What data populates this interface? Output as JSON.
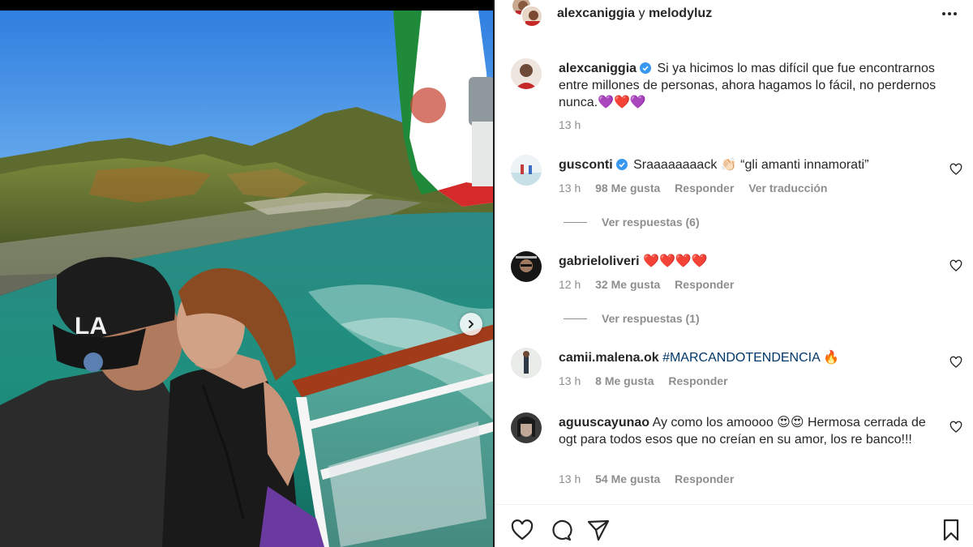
{
  "post": {
    "header": {
      "user1": "alexcaniggia",
      "conj": "y",
      "user2": "melodyluz"
    },
    "caption": {
      "username": "alexcaniggia",
      "text": "Si ya hicimos lo mas difícil que fue encontrarnos entre millones de personas, ahora hagamos lo fácil, no perdernos nunca.💜❤️💜",
      "time": "13 h"
    }
  },
  "comments": [
    {
      "username": "gusconti",
      "verified": true,
      "text": "Sraaaaaaaack 👏🏻 “gli amanti innamorati”",
      "time": "13 h",
      "likes": "98 Me gusta",
      "reply": "Responder",
      "translate": "Ver traducción",
      "view_replies": "Ver respuestas (6)"
    },
    {
      "username": "gabrieloliveri",
      "text": "❤️❤️❤️❤️",
      "time": "12 h",
      "likes": "32 Me gusta",
      "reply": "Responder",
      "view_replies": "Ver respuestas (1)"
    },
    {
      "username": "camii.malena.ok",
      "hashtag": "#MARCANDOTENDENCIA",
      "emoji": "🔥",
      "time": "13 h",
      "likes": "8 Me gusta",
      "reply": "Responder"
    },
    {
      "username": "aguuscayunao",
      "text": "Ay como los amoooo 😍😍 Hermosa cerrada de ogt para todos esos que no creían en su amor, los re banco!!!",
      "time": "13 h",
      "likes": "54 Me gusta",
      "reply": "Responder"
    }
  ],
  "icons": {
    "like": "heart-icon",
    "comment": "comment-icon",
    "share": "paper-plane-icon",
    "save": "bookmark-icon",
    "more": "more-horizontal-icon",
    "next": "chevron-right-icon",
    "verified": "verified-badge-icon"
  },
  "colors": {
    "text": "#262626",
    "muted": "#8e8e8e",
    "verified": "#3897f0",
    "hashtag": "#00376b"
  }
}
